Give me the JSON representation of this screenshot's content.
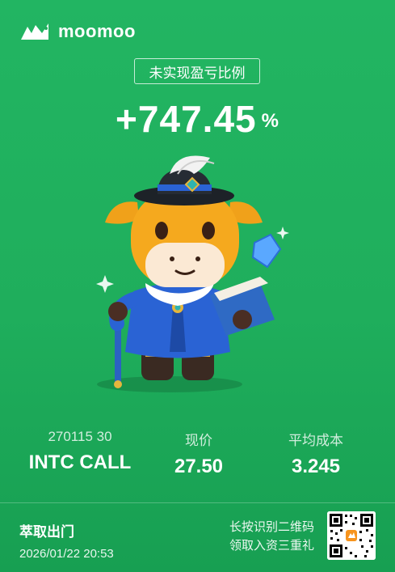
{
  "brand": {
    "name": "moomoo"
  },
  "header": {
    "title": "未实现盈亏比例",
    "value": "+747.45",
    "unit": "%"
  },
  "stats": [
    {
      "label": "270115 30",
      "value": "INTC CALL"
    },
    {
      "label": "现价",
      "value": "27.50"
    },
    {
      "label": "平均成本",
      "value": "3.245"
    }
  ],
  "footer": {
    "tagline": "萃取出门",
    "timestamp": "2026/01/22 20:53",
    "cta_line1": "长按识别二维码",
    "cta_line2": "领取入资三重礼"
  },
  "colors": {
    "background": "#1fae5c",
    "accent": "#ffffff"
  },
  "icons": [
    "moomoo-logo-icon",
    "mascot-illustration",
    "qr-code"
  ]
}
